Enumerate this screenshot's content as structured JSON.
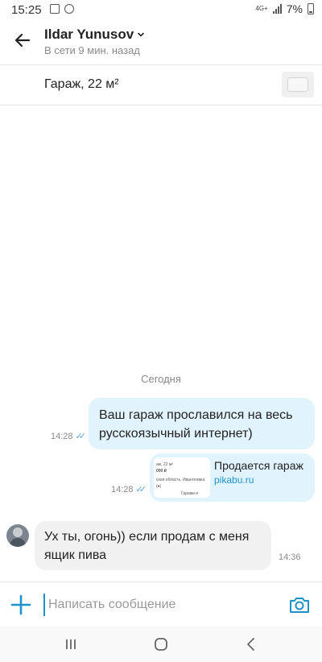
{
  "status_bar": {
    "time": "15:25",
    "network": "4G+",
    "battery": "7%"
  },
  "header": {
    "contact_name": "Ildar Yunusov",
    "last_seen": "В сети 9 мин. назад"
  },
  "ad": {
    "title": "Гараж, 22 м²"
  },
  "chat": {
    "day_separator": "Сегодня",
    "messages": [
      {
        "direction": "out",
        "text_line1": "Ваш гараж прославился на весь",
        "text_line2": "русскоязычный интернет)",
        "time": "14:28"
      },
      {
        "direction": "out",
        "link_title": "Продается гараж",
        "link_domain": "pikabu.ru",
        "time": "14:28"
      },
      {
        "direction": "in",
        "text_line1": "Ух ты, огонь)) если продам с меня",
        "text_line2": "ящик пива",
        "time": "14:36"
      }
    ]
  },
  "composer": {
    "placeholder": "Написать сообщение"
  },
  "colors": {
    "accent": "#1d93c9",
    "outgoing_bubble": "#e1f3fd",
    "incoming_bubble": "#f1f1f1",
    "read_check": "#5aa9e6"
  },
  "icons": {
    "back": "back-arrow-icon",
    "dropdown": "chevron-down-icon",
    "add": "plus-icon",
    "camera": "camera-icon",
    "nav_recent": "recent-apps-icon",
    "nav_home": "home-icon",
    "nav_back": "nav-back-icon"
  }
}
